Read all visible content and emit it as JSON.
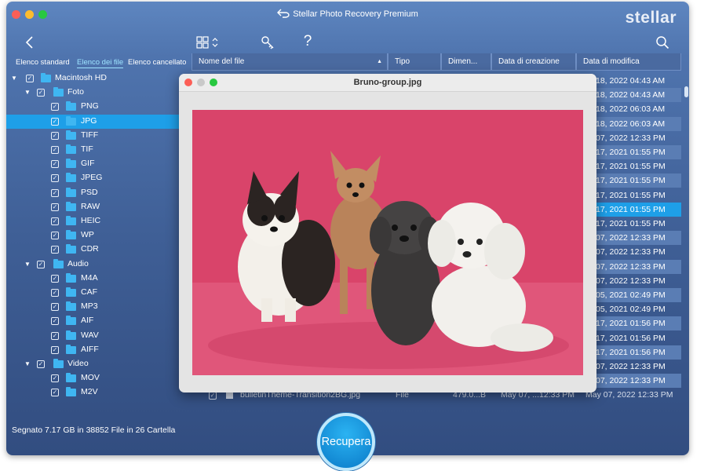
{
  "window": {
    "title": "Stellar Photo Recovery Premium",
    "brand": "stellar"
  },
  "toolbar": {
    "icons": [
      "back-icon",
      "grid-view-icon",
      "key-icon",
      "help-icon",
      "search-icon"
    ],
    "help_glyph": "?"
  },
  "tabs": [
    {
      "label": "Elenco standard",
      "active": false
    },
    {
      "label": "Elenco dei file",
      "active": true
    },
    {
      "label": "Elenco cancellato",
      "active": false
    }
  ],
  "columns": [
    "Nome del file",
    "Tipo",
    "Dimen...",
    "Data di creazione",
    "Data di modifica"
  ],
  "tree": [
    {
      "label": "Macintosh HD",
      "level": 0,
      "expanded": true
    },
    {
      "label": "Foto",
      "level": 1,
      "expanded": true
    },
    {
      "label": "PNG",
      "level": 2
    },
    {
      "label": "JPG",
      "level": 2,
      "selected": true
    },
    {
      "label": "TIFF",
      "level": 2
    },
    {
      "label": "TIF",
      "level": 2
    },
    {
      "label": "GIF",
      "level": 2
    },
    {
      "label": "JPEG",
      "level": 2
    },
    {
      "label": "PSD",
      "level": 2
    },
    {
      "label": "RAW",
      "level": 2
    },
    {
      "label": "HEIC",
      "level": 2
    },
    {
      "label": "WP",
      "level": 2
    },
    {
      "label": "CDR",
      "level": 2
    },
    {
      "label": "Audio",
      "level": 1,
      "expanded": true
    },
    {
      "label": "M4A",
      "level": 2
    },
    {
      "label": "CAF",
      "level": 2
    },
    {
      "label": "MP3",
      "level": 2
    },
    {
      "label": "AIF",
      "level": 2
    },
    {
      "label": "WAV",
      "level": 2
    },
    {
      "label": "AIFF",
      "level": 2
    },
    {
      "label": "Video",
      "level": 1,
      "expanded": true
    },
    {
      "label": "MOV",
      "level": 2
    },
    {
      "label": "M2V",
      "level": 2
    }
  ],
  "rows_modified": [
    "18, 2022 04:43 AM",
    "18, 2022 04:43 AM",
    "18, 2022 06:03 AM",
    "18, 2022 06:03 AM",
    "07, 2022 12:33 PM",
    "17, 2021 01:55 PM",
    "17, 2021 01:55 PM",
    "17, 2021 01:55 PM",
    "17, 2021 01:55 PM",
    "17, 2021 01:55 PM",
    "17, 2021 01:55 PM",
    "07, 2022 12:33 PM",
    "07, 2022 12:33 PM",
    "07, 2022 12:33 PM",
    "07, 2022 12:33 PM",
    "05, 2021 02:49 PM",
    "05, 2021 02:49 PM",
    "17, 2021 01:56 PM",
    "17, 2021 01:56 PM",
    "17, 2021 01:56 PM",
    "07, 2022 12:33 PM",
    "07, 2022 12:33 PM"
  ],
  "selected_row_index": 9,
  "bottom_row": {
    "name": "bulletinTheme-Transition2BG.jpg",
    "type": "File",
    "size": "479.0...B",
    "created": "May 07, ...12:33 PM",
    "modified": "May 07, 2022 12:33 PM"
  },
  "status": {
    "text": "Segnato 7.17 GB in 38852 File in 26 Cartella"
  },
  "recover_button": {
    "label": "Recupera"
  },
  "preview": {
    "title": "Bruno-group.jpg",
    "image_icon": "dogs-photo",
    "background_color": "#d9446a"
  },
  "colors": {
    "accent": "#1e9fe8",
    "window_top": "#5e86c0",
    "window_bottom": "#324d80",
    "folder": "#3fb6f2"
  }
}
